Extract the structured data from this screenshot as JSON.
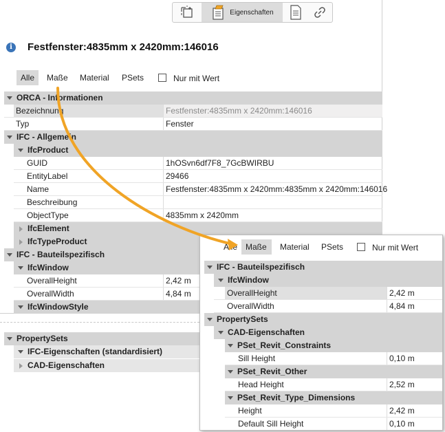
{
  "toolbar": {
    "properties_label": "Eigenschaften"
  },
  "main": {
    "title": "Festfenster:4835mm x 2420mm:146016",
    "tabs": [
      "Alle",
      "Maße",
      "Material",
      "PSets"
    ],
    "filter_label": "Nur mit Wert",
    "rows": {
      "g1": "ORCA - Informationen",
      "bez_k": "Bezeichnung",
      "bez_v": "Festfenster:4835mm x 2420mm:146016",
      "typ_k": "Typ",
      "typ_v": "Fenster",
      "g2": "IFC - Allgemein",
      "ifcproduct": "IfcProduct",
      "guid_k": "GUID",
      "guid_v": "1hOSvn6df7F8_7GcBWIRBU",
      "entity_k": "EntityLabel",
      "entity_v": "29466",
      "name_k": "Name",
      "name_v": "Festfenster:4835mm x 2420mm:4835mm x 2420mm:146016",
      "beschr_k": "Beschreibung",
      "beschr_v": "",
      "objtype_k": "ObjectType",
      "objtype_v": "4835mm x 2420mm",
      "ifcelement": "IfcElement",
      "ifctypeproduct": "IfcTypeProduct",
      "g3": "IFC - Bauteilspezifisch",
      "ifcwindow": "IfcWindow",
      "oh_k": "OverallHeight",
      "oh_v": "2,42 m",
      "ow_k": "OverallWidth",
      "ow_v": "4,84 m",
      "ifcwindowstyle": "IfcWindowStyle"
    },
    "psets": {
      "g": "PropertySets",
      "ifc_std": "IFC-Eigenschaften (standardisiert)",
      "cad": "CAD-Eigenschaften"
    }
  },
  "overlay": {
    "tabs": [
      "Alle",
      "Maße",
      "Material",
      "PSets"
    ],
    "filter_label": "Nur mit Wert",
    "rows": {
      "g1": "IFC - Bauteilspezifisch",
      "ifcwindow": "IfcWindow",
      "oh_k": "OverallHeight",
      "oh_v": "2,42 m",
      "ow_k": "OverallWidth",
      "ow_v": "4,84 m",
      "g2": "PropertySets",
      "cad": "CAD-Eigenschaften",
      "constraints": "PSet_Revit_Constraints",
      "sill_k": "Sill Height",
      "sill_v": "0,10 m",
      "other": "PSet_Revit_Other",
      "head_k": "Head Height",
      "head_v": "2,52 m",
      "dims": "PSet_Revit_Type_Dimensions",
      "height_k": "Height",
      "height_v": "2,42 m",
      "dsill_k": "Default Sill Height",
      "dsill_v": "0,10 m"
    }
  },
  "colors": {
    "group_bg": "#d4d4d4",
    "selected_bg": "#e0e0e0",
    "arrow": "#f0a426",
    "info": "#3a74b8"
  }
}
